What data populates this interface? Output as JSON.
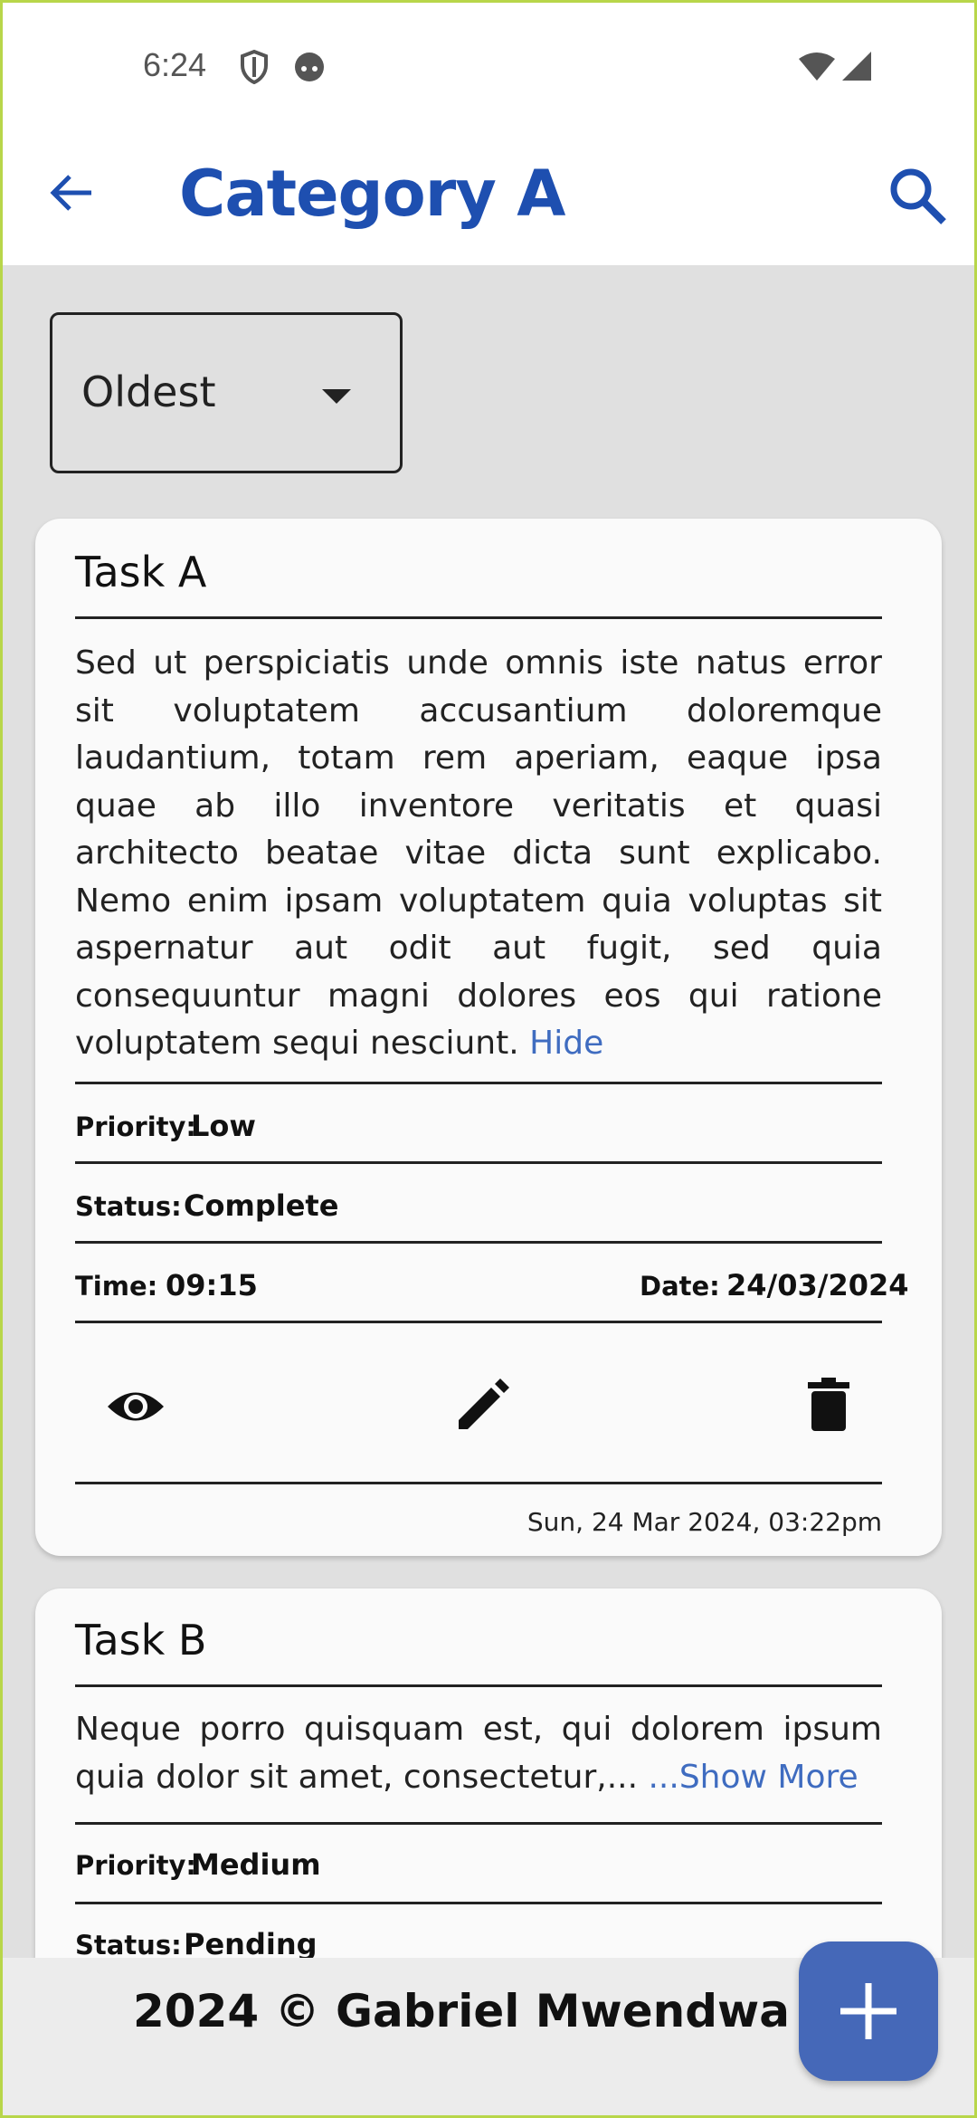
{
  "status_bar": {
    "time": "6:24",
    "icons": [
      "shield-icon",
      "face-icon",
      "wifi-icon",
      "signal-icon"
    ]
  },
  "app_bar": {
    "title": "Category A",
    "back_icon": "arrow-back-icon",
    "search_icon": "search-icon",
    "accent_color": "#1e4fb0"
  },
  "sort": {
    "selected": "Oldest"
  },
  "tasks": [
    {
      "title": "Task A",
      "description": "Sed ut perspiciatis unde omnis iste natus error sit voluptatem accusantium doloremque laudantium, totam rem aperiam, eaque ipsa quae ab illo inventore veritatis et quasi architecto beatae vitae dicta sunt explicabo. Nemo enim ipsam voluptatem quia voluptas sit aspernatur aut odit aut fugit, sed quia consequuntur magni dolores eos qui ratione voluptatem sequi nesciunt.",
      "toggle_label": "Hide",
      "priority_label": "Priority:",
      "priority": "Low",
      "status_label": "Status:",
      "status": "Complete",
      "time_label": "Time:",
      "time": "09:15",
      "date_label": "Date:",
      "date": "24/03/2024",
      "actions": [
        "eye-icon",
        "pencil-icon",
        "trash-icon"
      ],
      "created": "Sun, 24 Mar 2024, 03:22pm"
    },
    {
      "title": "Task B",
      "description": "Neque porro quisquam est, qui dolorem ipsum quia dolor sit amet, consectetur,...",
      "toggle_label": "...Show More",
      "priority_label": "Priority:",
      "priority": "Medium",
      "status_label": "Status:",
      "status": "Pending"
    }
  ],
  "footer": {
    "text": "2024 © Gabriel Mwendwa"
  },
  "fab": {
    "icon": "plus-icon",
    "color": "#4568b8"
  }
}
